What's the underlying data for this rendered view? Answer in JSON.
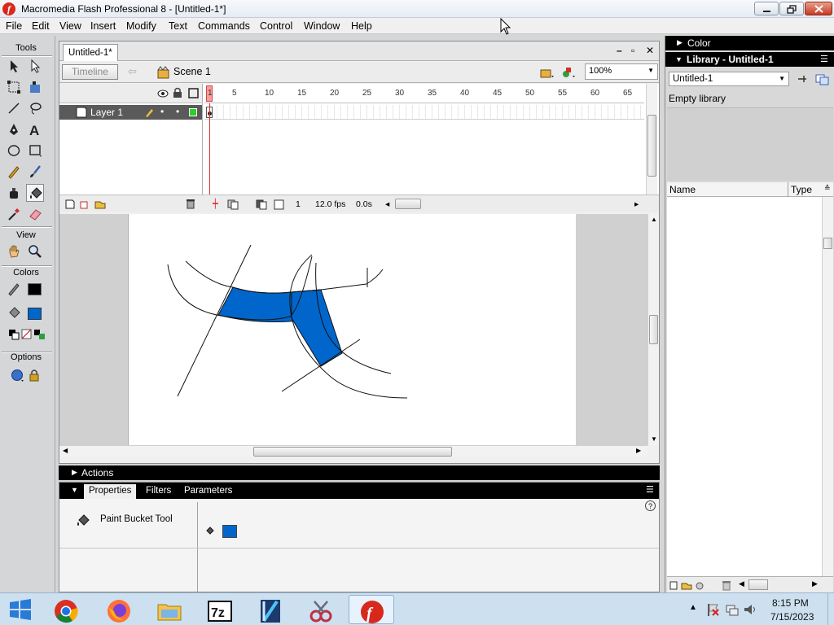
{
  "window": {
    "title": "Macromedia Flash Professional 8 - [Untitled-1*]"
  },
  "menu": [
    "File",
    "Edit",
    "View",
    "Insert",
    "Modify",
    "Text",
    "Commands",
    "Control",
    "Window",
    "Help"
  ],
  "tools": {
    "title": "Tools",
    "view_label": "View",
    "colors_label": "Colors",
    "options_label": "Options",
    "stroke_color": "#000000",
    "fill_color": "#0066cc"
  },
  "document": {
    "tab": "Untitled-1*",
    "timeline_button": "Timeline",
    "scene": "Scene 1",
    "zoom": "100%",
    "layer_name": "Layer 1",
    "frame_ticks": [
      "1",
      "5",
      "10",
      "15",
      "20",
      "25",
      "30",
      "35",
      "40",
      "45",
      "50",
      "55",
      "60",
      "65"
    ],
    "current_frame": "1",
    "fps": "12.0 fps",
    "elapsed": "0.0s"
  },
  "actions": {
    "label": "Actions"
  },
  "properties": {
    "tabs": [
      "Properties",
      "Filters",
      "Parameters"
    ],
    "tool_name": "Paint Bucket Tool",
    "fill_color": "#0066cc"
  },
  "right_panels": {
    "color_label": "Color",
    "library_label": "Library - Untitled-1",
    "library_select": "Untitled-1",
    "empty_text": "Empty library",
    "col_name": "Name",
    "col_type": "Type"
  },
  "taskbar": {
    "apps": [
      "chrome-icon",
      "firefox-icon",
      "file-explorer-icon",
      "7zip-icon",
      "kodi-icon",
      "snipping-tool-icon",
      "flash-icon"
    ],
    "time": "8:15 PM",
    "date": "7/15/2023"
  }
}
